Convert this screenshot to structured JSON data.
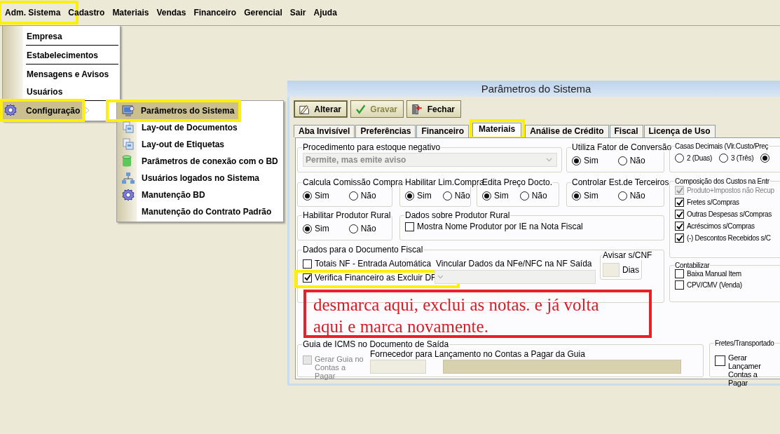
{
  "menu_bar": [
    {
      "label": "Adm. Sistema",
      "highlighted": true
    },
    {
      "label": "Cadastro",
      "highlighted": false
    },
    {
      "label": "Materiais",
      "highlighted": false
    },
    {
      "label": "Vendas",
      "highlighted": false
    },
    {
      "label": "Financeiro",
      "highlighted": false
    },
    {
      "label": "Gerencial",
      "highlighted": false
    },
    {
      "label": "Sair",
      "highlighted": false
    },
    {
      "label": "Ajuda",
      "highlighted": false
    }
  ],
  "menu": {
    "items": [
      {
        "label": "Empresa",
        "selected": false,
        "highlighted": false,
        "separator_after": true,
        "has_submenu": false
      },
      {
        "label": "Estabelecimentos",
        "selected": false,
        "highlighted": false,
        "separator_after": true,
        "has_submenu": false
      },
      {
        "label": "Mensagens e Avisos",
        "selected": false,
        "highlighted": false,
        "separator_after": false,
        "has_submenu": false
      },
      {
        "label": "Usuários",
        "selected": false,
        "highlighted": false,
        "separator_after": true,
        "has_submenu": false
      },
      {
        "label": "Configuração",
        "selected": true,
        "highlighted": true,
        "separator_after": false,
        "has_submenu": true
      }
    ]
  },
  "submenu": {
    "items": [
      {
        "label": "Parâmetros do Sistema",
        "selected": true,
        "highlighted": true
      },
      {
        "label": "Lay-out de Documentos",
        "selected": false,
        "highlighted": false
      },
      {
        "label": "Lay-out de Etiquetas",
        "selected": false,
        "highlighted": false
      },
      {
        "label": "Parâmetros de conexão com o BD",
        "selected": false,
        "highlighted": false
      },
      {
        "label": "Usuários logados no Sistema",
        "selected": false,
        "highlighted": false
      },
      {
        "label": "Manutenção BD",
        "selected": false,
        "highlighted": false
      },
      {
        "label": "Manutenção do Contrato Padrão",
        "selected": false,
        "highlighted": false
      }
    ]
  },
  "window": {
    "title": "Parâmetros do Sistema",
    "toolbar": [
      {
        "label": "Alterar",
        "disabled": false
      },
      {
        "label": "Gravar",
        "disabled": true
      },
      {
        "label": "Fechar",
        "disabled": false
      }
    ],
    "tabs": [
      {
        "label": "Aba Invisível",
        "selected": false,
        "highlighted": false
      },
      {
        "label": "Preferências",
        "selected": false,
        "highlighted": false
      },
      {
        "label": "Financeiro",
        "selected": false,
        "highlighted": false
      },
      {
        "label": "Materiais",
        "selected": true,
        "highlighted": true
      },
      {
        "label": "Análise de Crédito",
        "selected": false,
        "highlighted": false
      },
      {
        "label": "Fiscal",
        "selected": false,
        "highlighted": false
      },
      {
        "label": "Licença de Uso",
        "selected": false,
        "highlighted": false
      }
    ],
    "groups": [
      {
        "kind": "combo",
        "title": "Procedimento para estoque negativo",
        "value": "Permite, mas emite aviso",
        "disabled": true
      },
      {
        "kind": "radio",
        "title": "Utiliza Fator de Conversão",
        "options": [
          {
            "label": "Sim",
            "selected": true
          },
          {
            "label": "Não",
            "selected": false
          }
        ]
      },
      {
        "kind": "radio",
        "title": "Casas Decimais (Vlr.Custo/Preç",
        "options": [
          {
            "label": "2 (Duas)",
            "selected": false
          },
          {
            "label": "3 (Três)",
            "selected": false
          },
          {
            "selected": true
          }
        ]
      },
      {
        "kind": "radio",
        "title": "Calcula Comissão Compra",
        "options": [
          {
            "label": "Sim",
            "selected": true
          },
          {
            "label": "Não",
            "selected": false
          }
        ]
      },
      {
        "kind": "radio",
        "title": "Habilitar Lim.Compra",
        "options": [
          {
            "label": "Sim",
            "selected": true
          },
          {
            "label": "Não",
            "selected": false
          }
        ]
      },
      {
        "kind": "radio",
        "title": "Edita Preço Docto.",
        "options": [
          {
            "label": "Sim",
            "selected": true
          },
          {
            "label": "Não",
            "selected": false
          }
        ]
      },
      {
        "kind": "radio",
        "title": "Controlar Est.de Terceiros",
        "options": [
          {
            "label": "Sim",
            "selected": true
          },
          {
            "label": "Não",
            "selected": false
          }
        ]
      },
      {
        "kind": "checks",
        "title": "Composição dos Custos na Entr",
        "items": [
          {
            "label": "Produto+Impostos não Recup",
            "checked": true,
            "disabled": true,
            "highlighted": false
          },
          {
            "label": "Fretes s/Compras",
            "checked": true,
            "disabled": false,
            "highlighted": false
          },
          {
            "label": "Outras Despesas s/Compras",
            "checked": true,
            "disabled": false,
            "highlighted": false
          },
          {
            "label": "Acréscimos s/Compras",
            "checked": true,
            "disabled": false,
            "highlighted": false
          },
          {
            "label": "(-) Descontos Recebidos s/C",
            "checked": true,
            "disabled": false,
            "highlighted": false
          }
        ]
      },
      {
        "kind": "radio",
        "title": "Habilitar Produtor Rural",
        "options": [
          {
            "label": "Sim",
            "selected": true
          },
          {
            "label": "Não",
            "selected": false
          }
        ]
      },
      {
        "kind": "checks",
        "title": "Dados sobre Produtor Rural",
        "items": [
          {
            "label": "Mostra Nome Produtor por IE na Nota Fiscal",
            "checked": false,
            "disabled": false,
            "highlighted": false
          }
        ]
      },
      {
        "kind": "fiscal",
        "title": "Dados para o Documento Fiscal",
        "items": [
          {
            "label": "Totais NF - Entrada Automática",
            "checked": false,
            "disabled": false,
            "highlighted": false
          },
          {
            "label": "Verifica Financeiro as Excluir DF",
            "checked": true,
            "disabled": false,
            "highlighted": true
          }
        ],
        "combo_label": "Vincular Dados da NFe/NFC na NF Saída",
        "combo_disabled": true,
        "subgroup": {
          "title": "Avisar s/CNF",
          "unit": "Dias"
        }
      },
      {
        "kind": "checks",
        "title": "Contabilizar",
        "items": [
          {
            "label": "Baixa Manual Item",
            "checked": false,
            "disabled": false,
            "highlighted": false
          },
          {
            "label": "CPV/CMV (Venda)",
            "checked": false,
            "disabled": false,
            "highlighted": false
          }
        ]
      },
      {
        "kind": "guia",
        "title": "Guia de ICMS no Documento de Saída",
        "items": [
          {
            "label": "Gerar Guia no Contas a Pagar",
            "checked": false,
            "disabled": true,
            "highlighted": false
          }
        ],
        "field_label": "Fornecedor para Lançamento no Contas a Pagar da Guia"
      },
      {
        "kind": "checks",
        "title": "Fretes/Transportado",
        "items": [
          {
            "label": "Gerar Lançamer Contas a Pagar",
            "checked": false,
            "disabled": false,
            "highlighted": false
          }
        ]
      }
    ]
  },
  "note": {
    "text": "desmarca aqui, exclui as notas. e já volta aqui e marca novamente."
  }
}
